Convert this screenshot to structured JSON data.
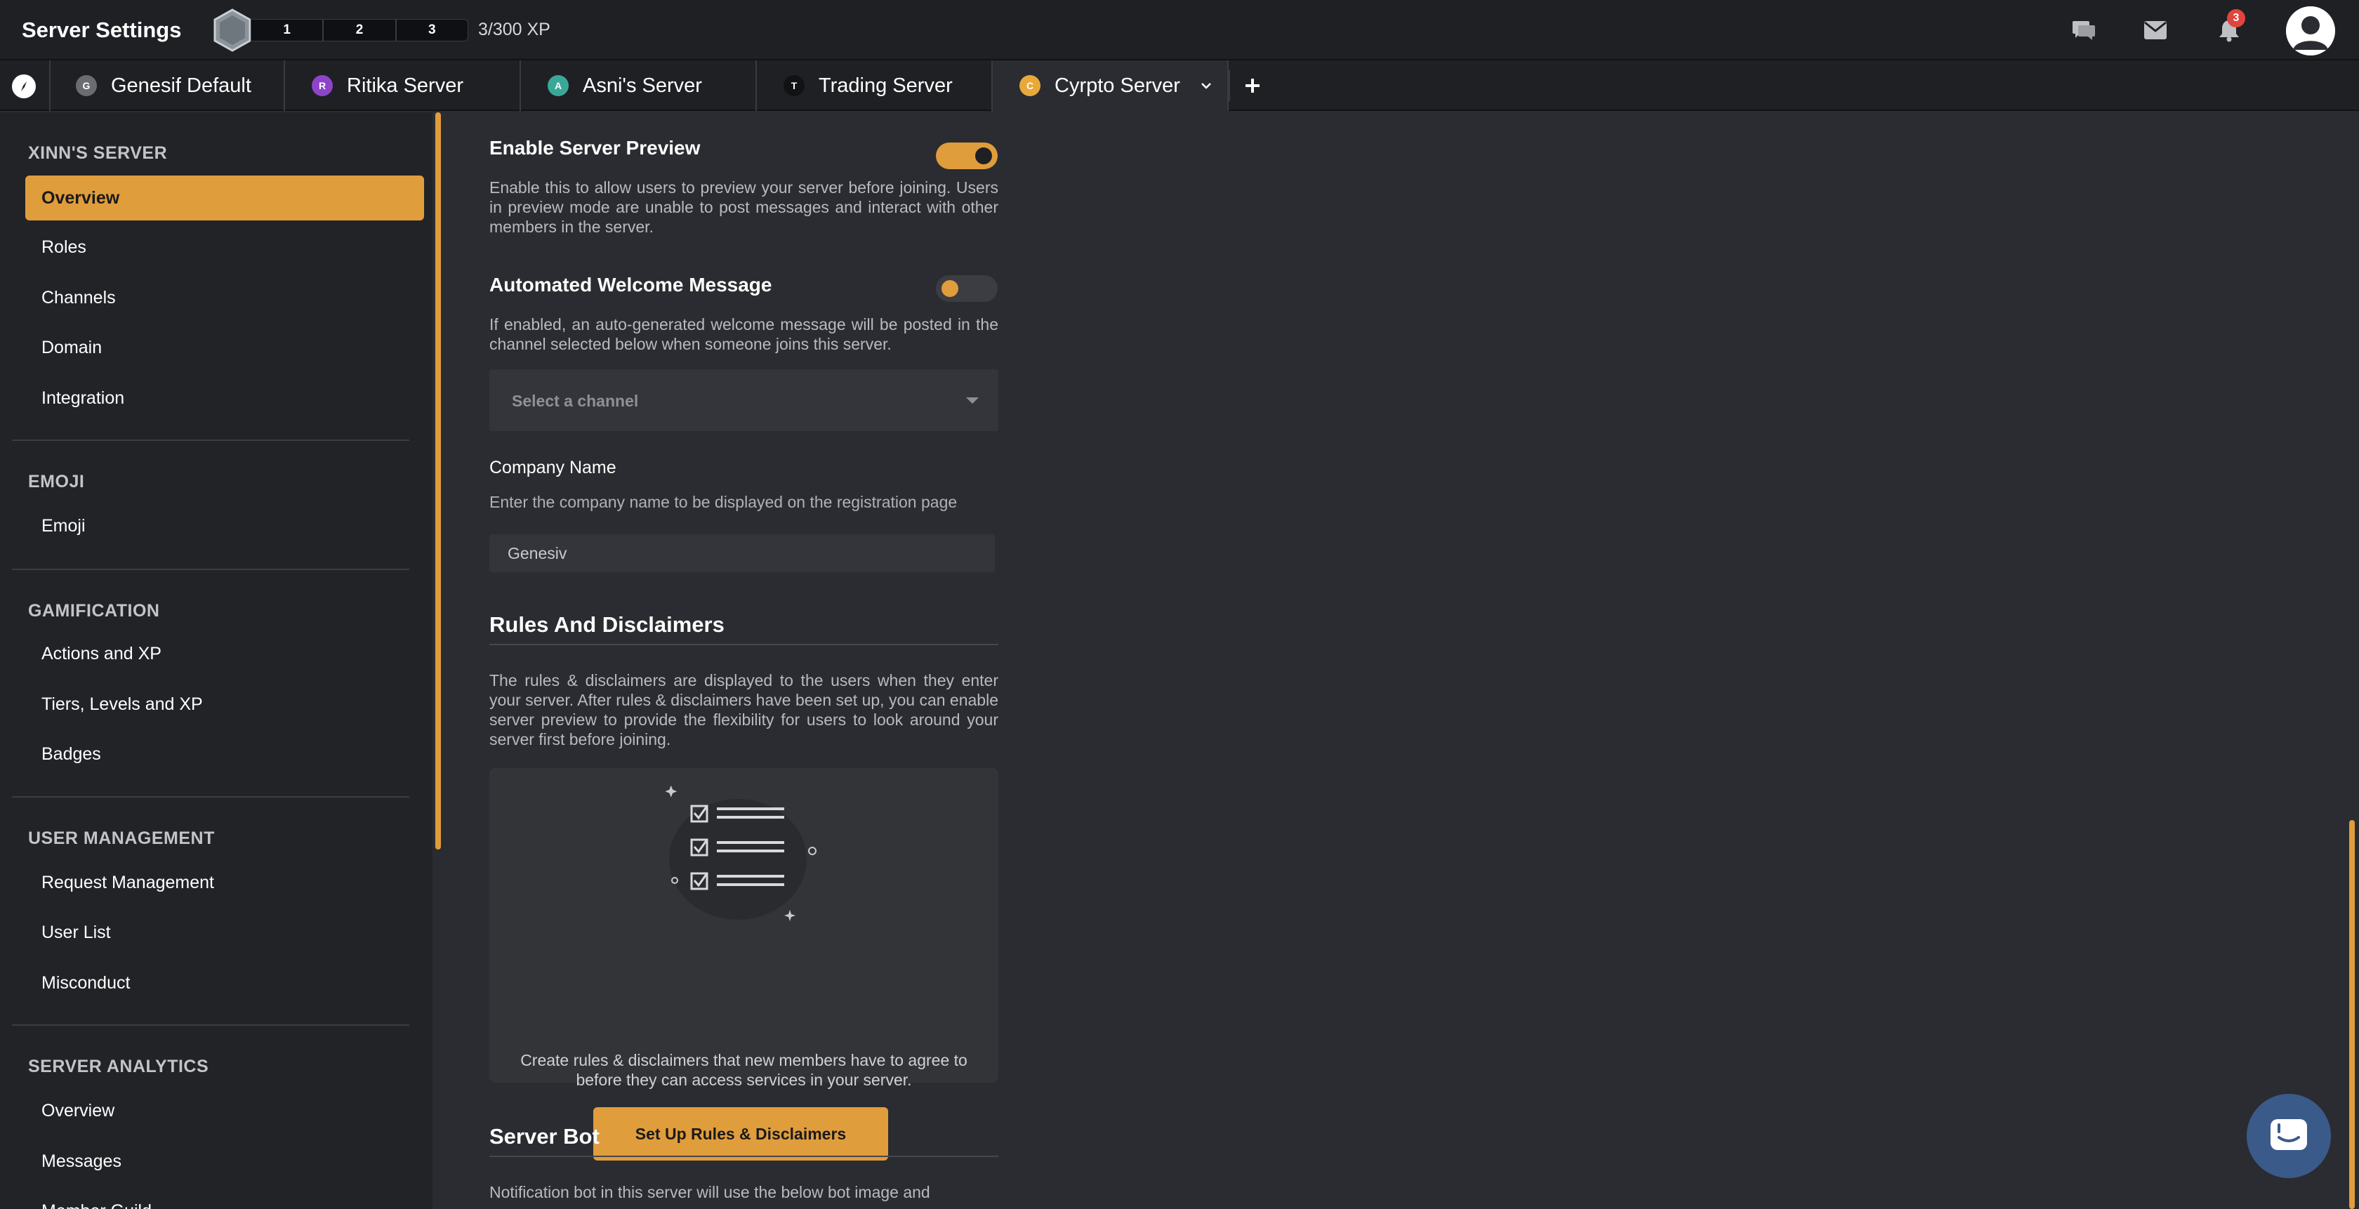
{
  "header": {
    "title": "Server Settings",
    "xp_levels": [
      "1",
      "2",
      "3"
    ],
    "xp_text": "3/300 XP",
    "notification_count": "3",
    "icons": [
      "chat-icon",
      "mail-icon",
      "bell-icon",
      "avatar"
    ]
  },
  "tabs": [
    {
      "initial": "G",
      "label": "Genesif Default",
      "color": "#6b6c70"
    },
    {
      "initial": "R",
      "label": "Ritika Server",
      "color": "#8e44c9"
    },
    {
      "initial": "A",
      "label": "Asni's Server",
      "color": "#3aa896"
    },
    {
      "initial": "T",
      "label": "Trading Server",
      "color": "#111214"
    },
    {
      "initial": "C",
      "label": "Cyrpto Server",
      "color": "#e8a93a"
    }
  ],
  "sidebar": {
    "sections": [
      {
        "title": "XINN'S SERVER",
        "items": [
          "Overview",
          "Roles",
          "Channels",
          "Domain",
          "Integration"
        ]
      },
      {
        "title": "EMOJI",
        "items": [
          "Emoji"
        ]
      },
      {
        "title": "GAMIFICATION",
        "items": [
          "Actions and XP",
          "Tiers, Levels and XP",
          "Badges"
        ]
      },
      {
        "title": "USER MANAGEMENT",
        "items": [
          "Request Management",
          "User List",
          "Misconduct"
        ]
      },
      {
        "title": "SERVER ANALYTICS",
        "items": [
          "Overview",
          "Messages",
          "Member Guild..."
        ]
      }
    ],
    "active_item": "Overview"
  },
  "main": {
    "server_preview": {
      "title": "Enable Server Preview",
      "enabled": true,
      "description": "Enable this to allow users to preview your server before joining. Users in preview mode are unable to post messages and interact with other members in the server."
    },
    "welcome_message": {
      "title": "Automated Welcome Message",
      "enabled": false,
      "description": "If enabled, an auto-generated welcome message will be posted in the channel selected below when someone joins this server.",
      "channel_placeholder": "Select a channel"
    },
    "company": {
      "label": "Company Name",
      "description": "Enter the company name to be displayed on the registration page",
      "value": "Genesiv"
    },
    "rules": {
      "heading": "Rules And Disclaimers",
      "description": "The rules & disclaimers are displayed to the users when they enter your server. After rules & disclaimers have been set up, you can enable server preview to provide the flexibility for users to look around your server first before joining.",
      "card_text_1": "Create rules & disclaimers that new members have to agree to",
      "card_text_2": "before they can access services in your server.",
      "button": "Set Up Rules & Disclaimers"
    },
    "server_bot": {
      "heading": "Server Bot",
      "description": "Notification bot in this server will use the below bot image and"
    }
  },
  "colors": {
    "accent": "#e09d3c",
    "background": "#2b2c31",
    "sidebar": "#222327",
    "topbar": "#1f2024"
  }
}
